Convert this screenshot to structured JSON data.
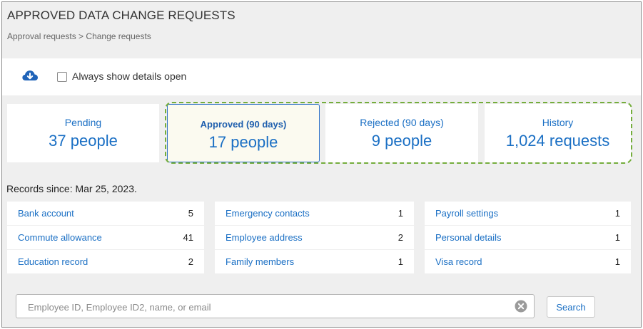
{
  "page": {
    "title": "APPROVED DATA CHANGE REQUESTS",
    "breadcrumb": "Approval requests > Change requests"
  },
  "toolbar": {
    "download_icon": "cloud-download-icon",
    "always_show_details_label": "Always show details open",
    "always_show_details_checked": false
  },
  "summary_cards": [
    {
      "label": "Pending",
      "value": "37 people",
      "active": false
    },
    {
      "label": "Approved (90 days)",
      "value": "17 people",
      "active": true
    },
    {
      "label": "Rejected (90 days)",
      "value": "9 people",
      "active": false
    },
    {
      "label": "History",
      "value": "1,024 requests",
      "active": false
    }
  ],
  "records_since": "Records since: Mar 25, 2023.",
  "record_columns": [
    [
      {
        "name": "Bank account",
        "count": "5"
      },
      {
        "name": "Commute allowance",
        "count": "41"
      },
      {
        "name": "Education record",
        "count": "2"
      }
    ],
    [
      {
        "name": "Emergency contacts",
        "count": "1"
      },
      {
        "name": "Employee address",
        "count": "2"
      },
      {
        "name": "Family members",
        "count": "1"
      }
    ],
    [
      {
        "name": "Payroll settings",
        "count": "1"
      },
      {
        "name": "Personal details",
        "count": "1"
      },
      {
        "name": "Visa record",
        "count": "1"
      }
    ]
  ],
  "search": {
    "placeholder": "Employee ID, Employee ID2, name, or email",
    "value": "",
    "button_label": "Search"
  },
  "colors": {
    "link": "#1a6fc4",
    "active_border": "#2f73c8",
    "highlight_dash": "#74ad3c",
    "background": "#efefef"
  }
}
